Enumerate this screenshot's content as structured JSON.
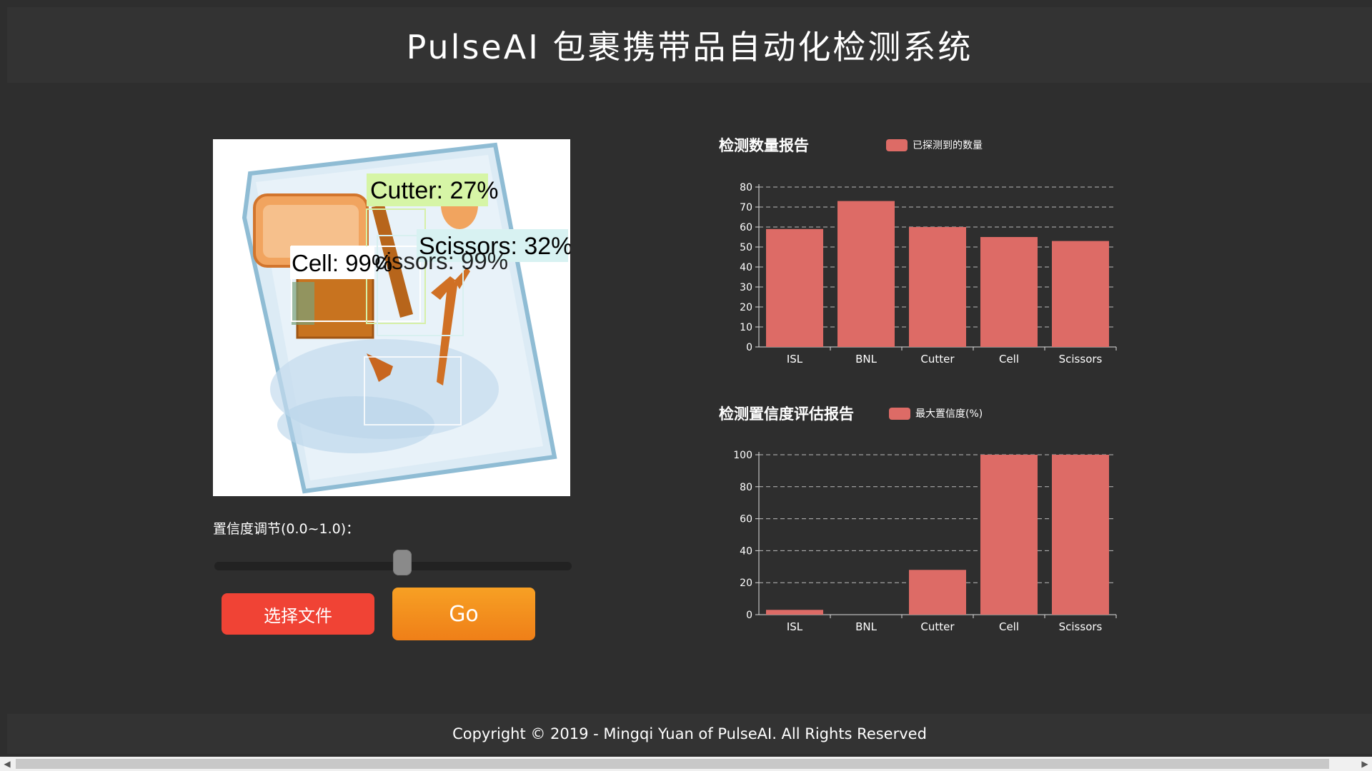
{
  "header": {
    "title": "PulseAI 包裹携带品自动化检测系统"
  },
  "preview": {
    "detections": [
      {
        "label": "Cutter: 27%"
      },
      {
        "label": "Scissors: 32%"
      },
      {
        "label": "Cell: 99%"
      },
      {
        "label": "cissors: 99%"
      }
    ]
  },
  "controls": {
    "slider_label": "置信度调节(0.0~1.0)：",
    "slider_value": 0.55,
    "file_button": "选择文件",
    "go_button": "Go"
  },
  "charts": {
    "count_title": "检测数量报告",
    "count_legend": "已探测到的数量",
    "conf_title": "检测置信度评估报告",
    "conf_legend": "最大置信度(%)"
  },
  "colors": {
    "bar": "#dd6b66",
    "background": "#2e2e2e",
    "header": "#333333",
    "go": "#f39220",
    "file": "#f04335"
  },
  "chart_data": [
    {
      "type": "bar",
      "title": "检测数量报告",
      "categories": [
        "ISL",
        "BNL",
        "Cutter",
        "Cell",
        "Scissors"
      ],
      "series": [
        {
          "name": "已探测到的数量",
          "values": [
            59,
            73,
            60,
            55,
            53
          ]
        }
      ],
      "ylim": [
        0,
        80
      ],
      "yticks": [
        0,
        10,
        20,
        30,
        40,
        50,
        60,
        70,
        80
      ],
      "grid": true,
      "legend": "top"
    },
    {
      "type": "bar",
      "title": "检测置信度评估报告",
      "categories": [
        "ISL",
        "BNL",
        "Cutter",
        "Cell",
        "Scissors"
      ],
      "series": [
        {
          "name": "最大置信度(%)",
          "values": [
            3,
            0,
            28,
            100,
            100
          ]
        }
      ],
      "ylim": [
        0,
        100
      ],
      "yticks": [
        0,
        20,
        40,
        60,
        80,
        100
      ],
      "grid": true,
      "legend": "top"
    }
  ],
  "footer": {
    "copyright": "Copyright © 2019 - Mingqi Yuan of PulseAI. All Rights Reserved"
  }
}
